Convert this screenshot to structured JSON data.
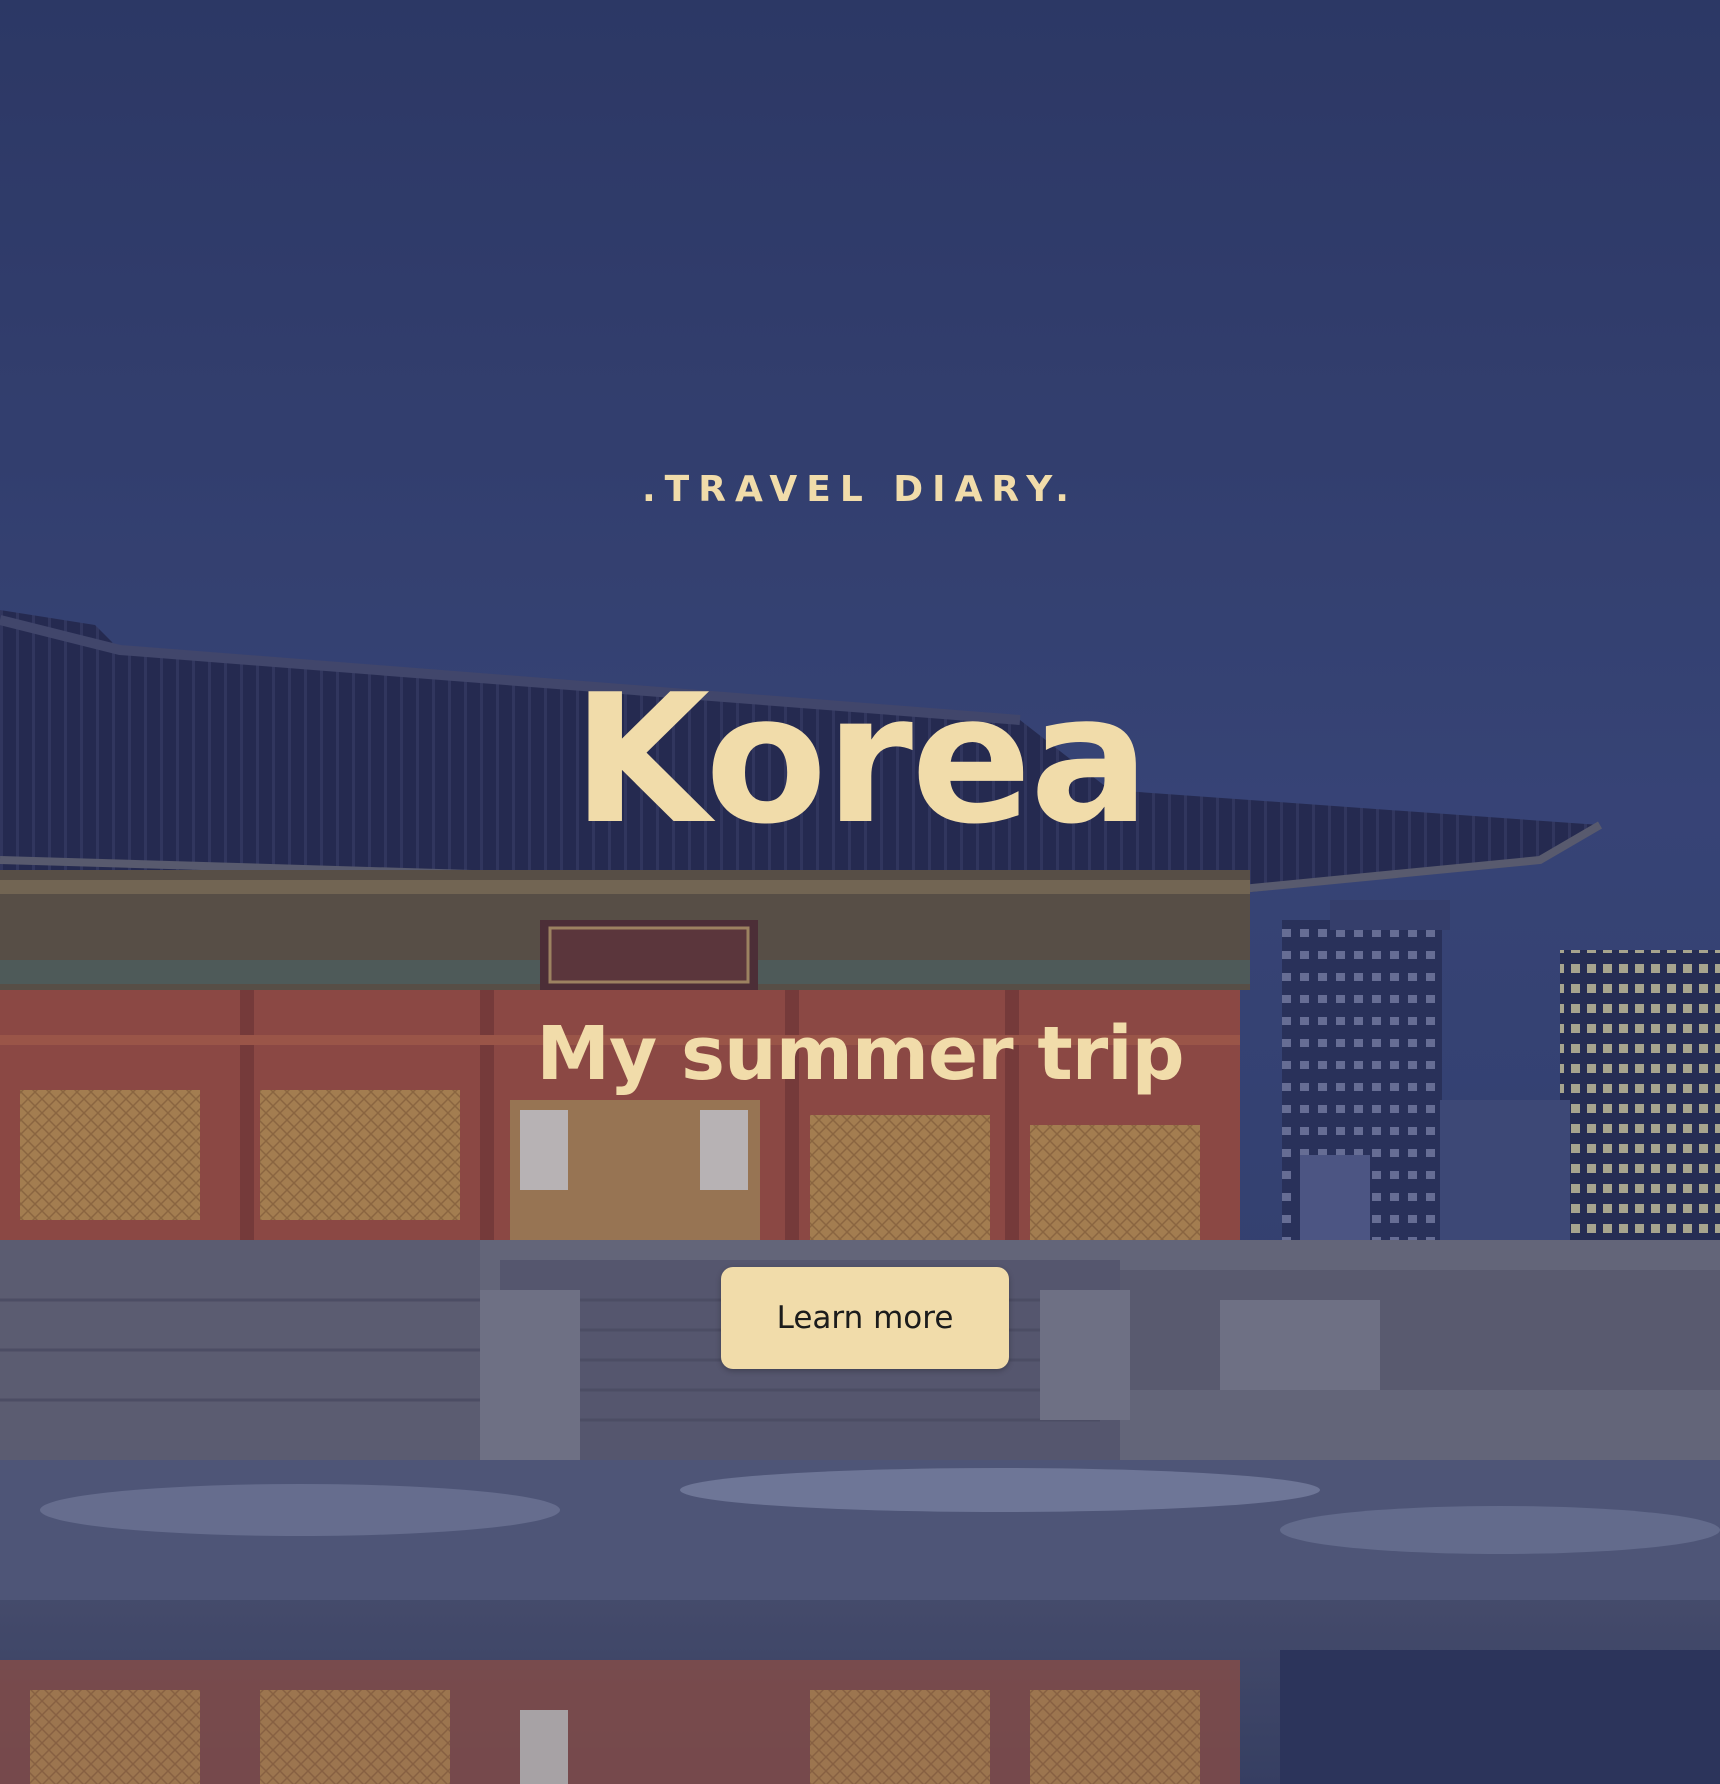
{
  "hero": {
    "eyebrow": ".TRAVEL DIARY.",
    "title": "Korea",
    "subtitle": "My summer trip",
    "cta_label": "Learn more"
  },
  "background": {
    "description_icon": "palace-photo",
    "sky_color": "#3a4a7a",
    "roof_color": "#2a2f4a",
    "pillar_color": "#b2533a",
    "panel_color": "#d7a04c",
    "stone_color": "#7d7c86",
    "water_color": "#4a5170"
  },
  "colors": {
    "accent": "#f1dcaa",
    "button_text": "#1c1c1c"
  }
}
